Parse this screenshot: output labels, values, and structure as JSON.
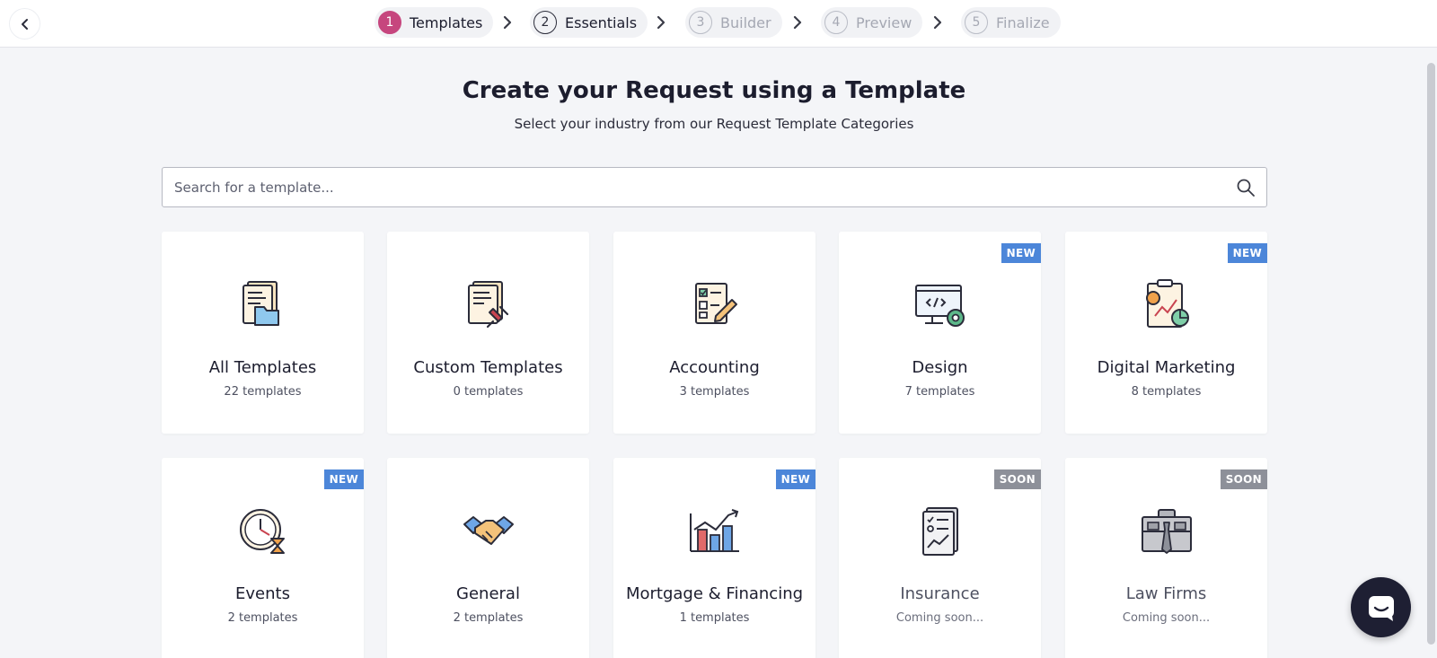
{
  "steps": [
    {
      "num": "1",
      "label": "Templates",
      "state": "active"
    },
    {
      "num": "2",
      "label": "Essentials",
      "state": "done"
    },
    {
      "num": "3",
      "label": "Builder",
      "state": "todo"
    },
    {
      "num": "4",
      "label": "Preview",
      "state": "todo"
    },
    {
      "num": "5",
      "label": "Finalize",
      "state": "todo"
    }
  ],
  "header": {
    "title": "Create your Request using a Template",
    "subtitle": "Select your industry from our Request Template Categories"
  },
  "search": {
    "placeholder": "Search for a template..."
  },
  "colors": {
    "accent": "#c6467e",
    "badge_new": "#4c86d9",
    "badge_soon": "#8d9099",
    "chat": "#1e1f33"
  },
  "cards": [
    {
      "name": "All Templates",
      "count": "22 templates",
      "badge": "",
      "icon": "folder-documents-icon"
    },
    {
      "name": "Custom Templates",
      "count": "0 templates",
      "badge": "",
      "icon": "pinned-document-icon"
    },
    {
      "name": "Accounting",
      "count": "3 templates",
      "badge": "",
      "icon": "checklist-pencil-icon"
    },
    {
      "name": "Design",
      "count": "7 templates",
      "badge": "NEW",
      "icon": "code-monitor-gear-icon"
    },
    {
      "name": "Digital Marketing",
      "count": "8 templates",
      "badge": "NEW",
      "icon": "clipboard-chart-icon"
    },
    {
      "name": "Events",
      "count": "2 templates",
      "badge": "NEW",
      "icon": "clock-hourglass-icon"
    },
    {
      "name": "General",
      "count": "2 templates",
      "badge": "",
      "icon": "handshake-icon"
    },
    {
      "name": "Mortgage & Financing",
      "count": "1 templates",
      "badge": "NEW",
      "icon": "bar-chart-growth-icon"
    },
    {
      "name": "Insurance",
      "count": "Coming soon...",
      "badge": "SOON",
      "icon": "checklist-document-icon"
    },
    {
      "name": "Law Firms",
      "count": "Coming soon...",
      "badge": "SOON",
      "icon": "briefcase-icon"
    }
  ]
}
